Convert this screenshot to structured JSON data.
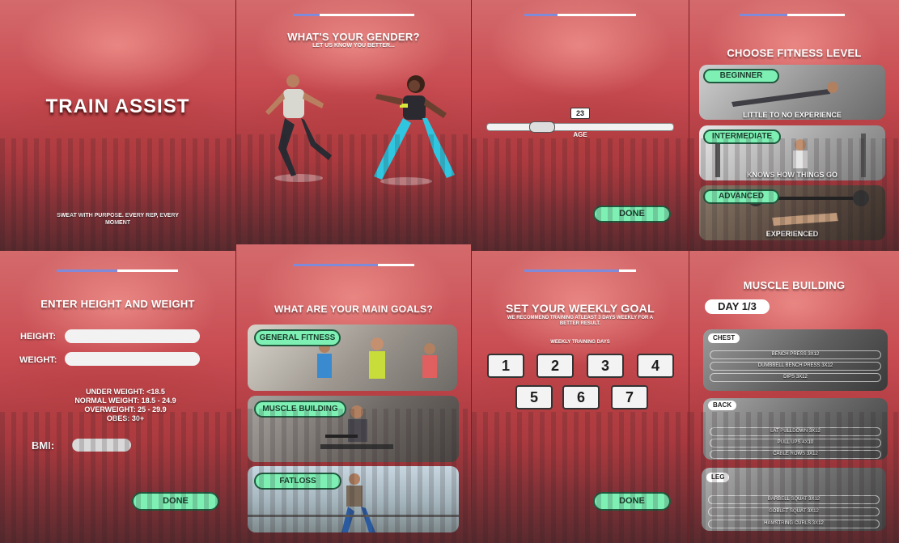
{
  "splash": {
    "title": "TRAIN ASSIST",
    "tagline": "SWEAT WITH PURPOSE. EVERY REP, EVERY MOMENT"
  },
  "gender": {
    "title": "WHAT'S YOUR GENDER?",
    "subtitle": "LET US KNOW YOU BETTER...",
    "progress": 0.22
  },
  "age": {
    "value": "23",
    "label": "AGE",
    "done_label": "DONE",
    "progress": 0.3
  },
  "fitness": {
    "title": "CHOOSE FITNESS LEVEL",
    "progress": 0.45,
    "levels": [
      {
        "tag": "BEGINNER",
        "caption": "LITTLE TO NO EXPERIENCE"
      },
      {
        "tag": "INTERMEDIATE",
        "caption": "KNOWS HOW THINGS GO"
      },
      {
        "tag": "ADVANCED",
        "caption": "EXPERIENCED"
      }
    ]
  },
  "height_weight": {
    "title": "ENTER HEIGHT AND WEIGHT",
    "progress": 0.5,
    "height_label": "HEIGHT:",
    "weight_label": "WEIGHT:",
    "bmi_ranges": [
      "UNDER WEIGHT: <18.5",
      "NORMAL WEIGHT: 18.5 - 24.9",
      "OVERWEIGHT: 25 - 29.9",
      "OBES: 30+"
    ],
    "bmi_label": "BMI:",
    "done_label": "DONE"
  },
  "goals": {
    "title": "WHAT ARE YOUR MAIN GOALS?",
    "progress": 0.7,
    "options": [
      {
        "tag": "GENERAL FITNESS"
      },
      {
        "tag": "MUSCLE BUILDING"
      },
      {
        "tag": "FATLOSS"
      }
    ]
  },
  "weekly": {
    "title": "SET YOUR WEEKLY GOAL",
    "subtitle": "WE RECOMMEND TRAINING ATLEAST 3 DAYS WEEKLY FOR A BETTER RESULT.",
    "days_label": "WEEKLY TRAINING DAYS",
    "days": [
      "1",
      "2",
      "3",
      "4",
      "5",
      "6",
      "7"
    ],
    "done_label": "DONE",
    "progress": 0.85
  },
  "program": {
    "title": "MUSCLE BUILDING",
    "day_label": "DAY 1/3",
    "sections": [
      {
        "tag": "CHEST",
        "exercises": [
          "BENCH PRESS 3X12",
          "DUMBBELL BENCH PRESS 3X12",
          "DIPS 3X12"
        ]
      },
      {
        "tag": "BACK",
        "exercises": [
          "LAT PULLDOWN 3X12",
          "PULL UPS 4X10",
          "CABLE ROWS 3X12"
        ]
      },
      {
        "tag": "LEG",
        "exercises": [
          "BARBELL SQUAT 3X12",
          "GOBLET SQUAT 3X12",
          "HAMSTRING CURLS 3X12"
        ]
      }
    ]
  },
  "colors": {
    "accent": "#7ef0b4",
    "progress": "#7f8bd8",
    "panel_red": "#c84c52"
  }
}
